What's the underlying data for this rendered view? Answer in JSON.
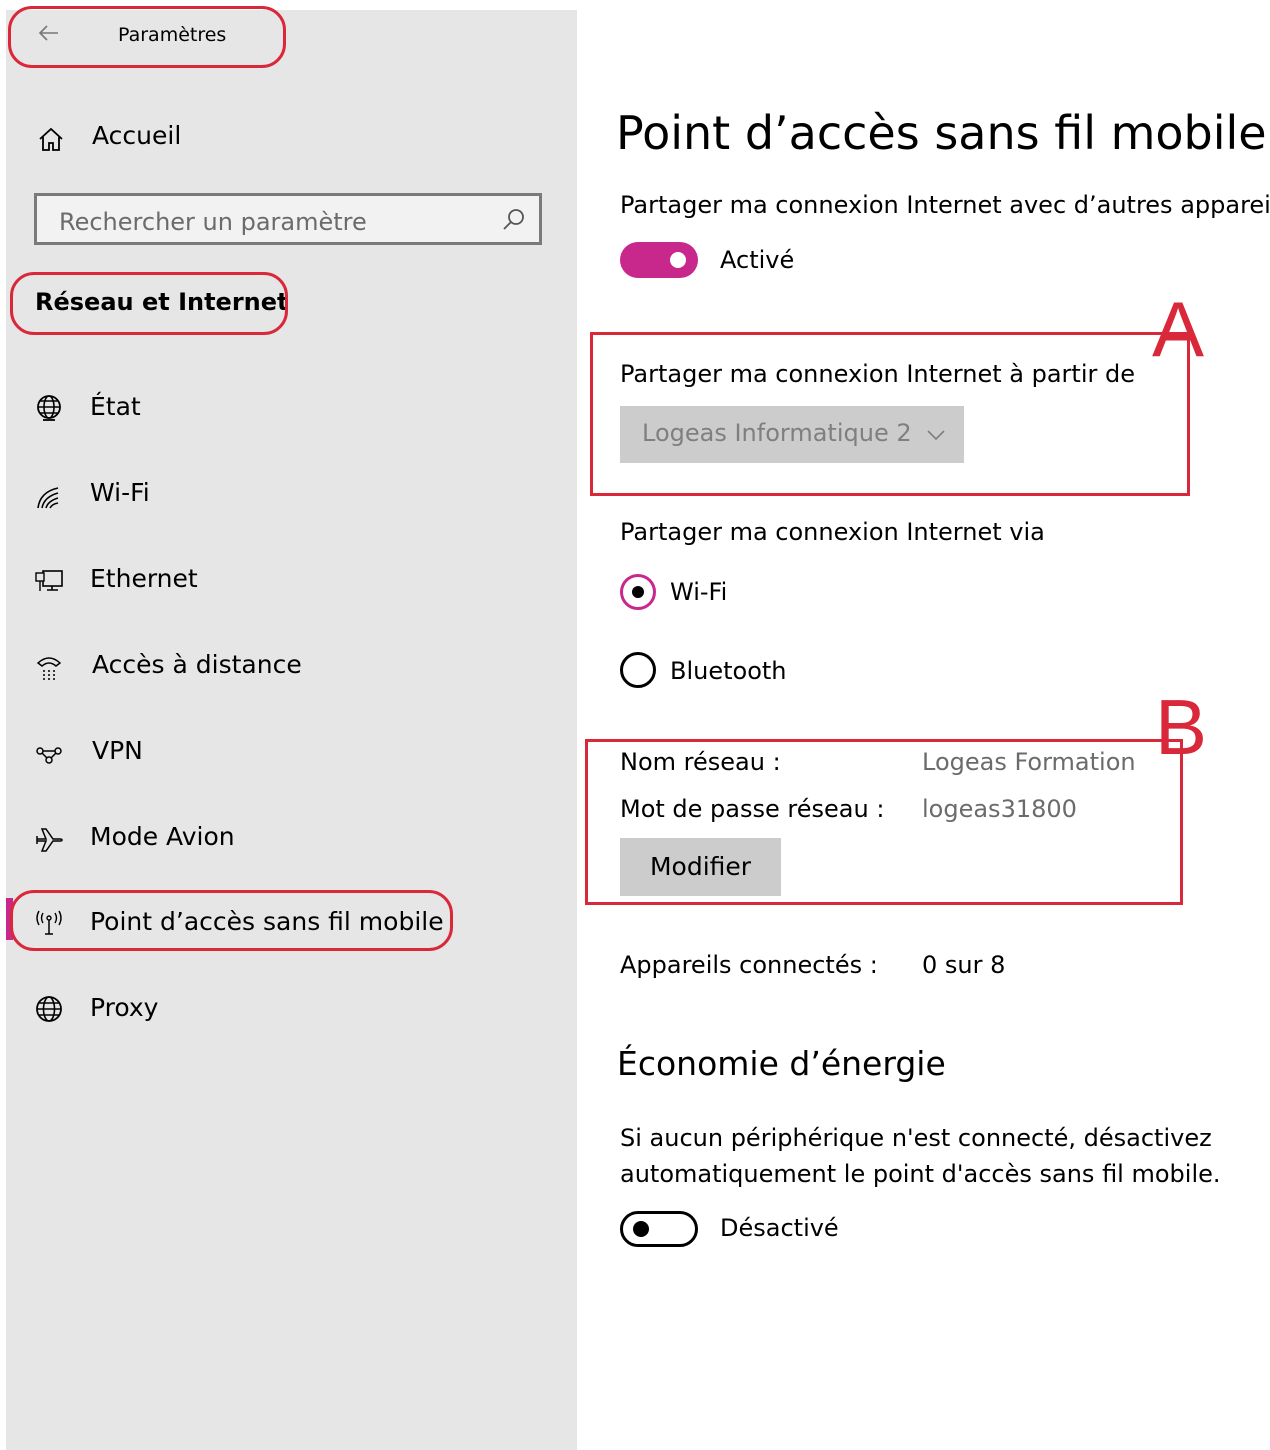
{
  "window": {
    "title": "Paramètres"
  },
  "sidebar": {
    "home_label": "Accueil",
    "search_placeholder": "Rechercher un paramètre",
    "section_title": "Réseau et Internet",
    "items": [
      {
        "label": "État",
        "icon": "globe-status-icon"
      },
      {
        "label": "Wi-Fi",
        "icon": "wifi-icon"
      },
      {
        "label": "Ethernet",
        "icon": "ethernet-icon"
      },
      {
        "label": "Accès à distance",
        "icon": "dialup-icon"
      },
      {
        "label": "VPN",
        "icon": "vpn-icon"
      },
      {
        "label": "Mode Avion",
        "icon": "airplane-icon"
      },
      {
        "label": "Point d’accès sans fil mobile",
        "icon": "hotspot-icon",
        "selected": true
      },
      {
        "label": "Proxy",
        "icon": "globe-icon"
      }
    ]
  },
  "main": {
    "title": "Point d’accès sans fil mobile",
    "share_label": "Partager ma connexion Internet avec d’autres appareils",
    "share_toggle_state": "Activé",
    "share_from_label": "Partager ma connexion Internet à partir de",
    "share_from_value": "Logeas Informatique 2",
    "share_via_label": "Partager ma connexion Internet via",
    "share_via_options": [
      "Wi-Fi",
      "Bluetooth"
    ],
    "network_name_label": "Nom réseau :",
    "network_name_value": "Logeas Formation",
    "network_password_label": "Mot de passe réseau :",
    "network_password_value": "logeas31800",
    "edit_button": "Modifier",
    "connected_label": "Appareils connectés :",
    "connected_value": "0 sur 8",
    "power_saving_title": "Économie d’énergie",
    "power_saving_desc_1": "Si aucun périphérique n'est connecté, désactivez",
    "power_saving_desc_2": "automatiquement le point d'accès sans fil mobile.",
    "power_saving_toggle_state": "Désactivé"
  },
  "annotations": {
    "a": "A",
    "b": "B"
  },
  "colors": {
    "accent": "#c8288c",
    "annotation_red": "#d9283a",
    "sidebar_bg": "#e6e6e6"
  }
}
